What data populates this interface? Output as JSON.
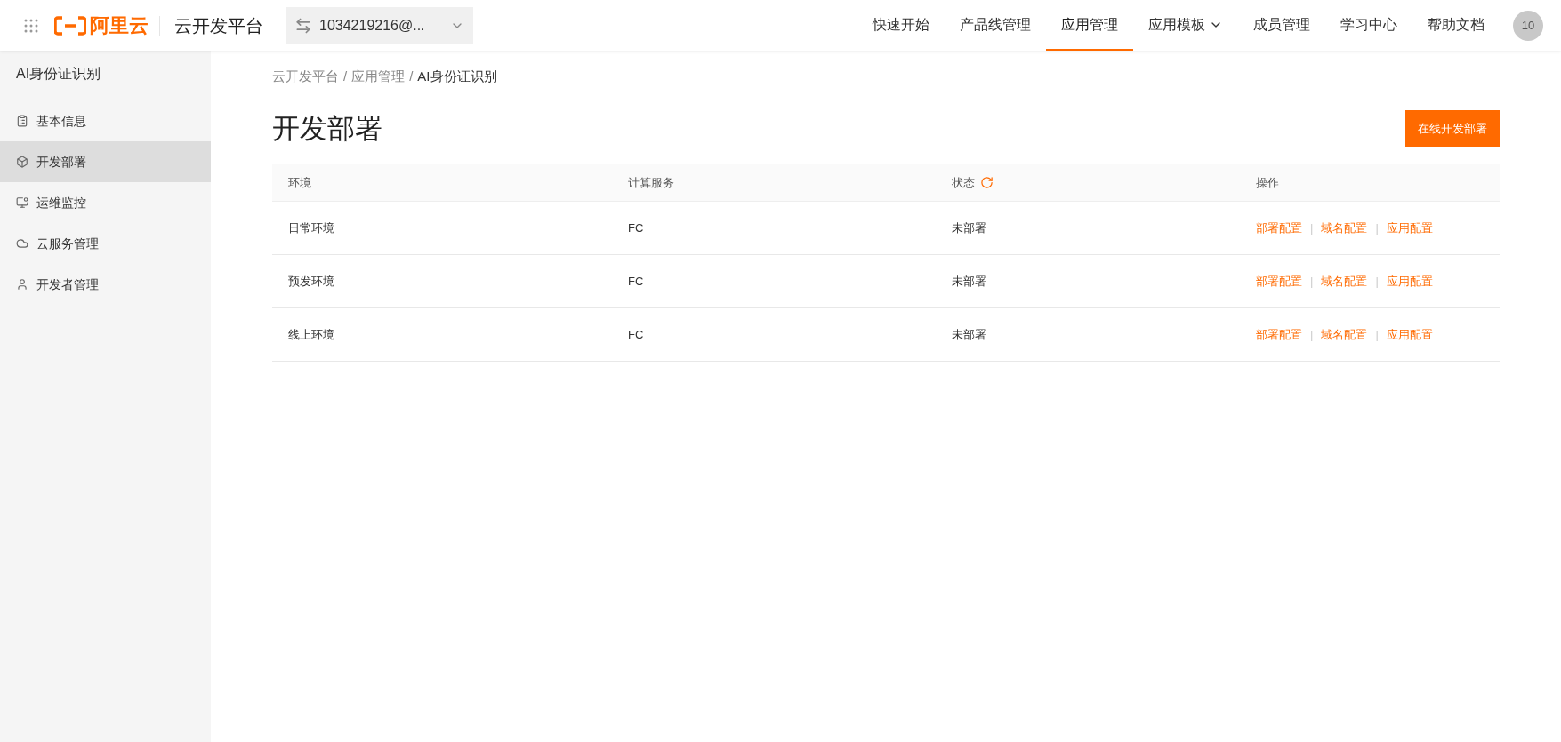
{
  "header": {
    "logo_text": "阿里云",
    "platform": "云开发平台",
    "account": "1034219216@...",
    "nav": [
      {
        "label": "快速开始",
        "selected": false,
        "dropdown": false
      },
      {
        "label": "产品线管理",
        "selected": false,
        "dropdown": false
      },
      {
        "label": "应用管理",
        "selected": true,
        "dropdown": false
      },
      {
        "label": "应用模板",
        "selected": false,
        "dropdown": true
      },
      {
        "label": "成员管理",
        "selected": false,
        "dropdown": false
      },
      {
        "label": "学习中心",
        "selected": false,
        "dropdown": false
      },
      {
        "label": "帮助文档",
        "selected": false,
        "dropdown": false
      }
    ],
    "avatar": "10"
  },
  "sidebar": {
    "title": "AI身份证识别",
    "items": [
      {
        "label": "基本信息",
        "kind": "doc",
        "selected": false
      },
      {
        "label": "开发部署",
        "kind": "cube",
        "selected": true
      },
      {
        "label": "运维监控",
        "kind": "monitor",
        "selected": false
      },
      {
        "label": "云服务管理",
        "kind": "cloud",
        "selected": false
      },
      {
        "label": "开发者管理",
        "kind": "user",
        "selected": false
      }
    ]
  },
  "breadcrumb": {
    "separator": "/",
    "items": [
      "云开发平台",
      "应用管理",
      "AI身份证识别"
    ]
  },
  "page_title": "开发部署",
  "primary_button": "在线开发部署",
  "table": {
    "columns": [
      "环境",
      "计算服务",
      "状态",
      "操作"
    ],
    "rows": [
      {
        "env": "日常环境",
        "service": "FC",
        "status": "未部署",
        "actions": [
          "部署配置",
          "域名配置",
          "应用配置"
        ]
      },
      {
        "env": "预发环境",
        "service": "FC",
        "status": "未部署",
        "actions": [
          "部署配置",
          "域名配置",
          "应用配置"
        ]
      },
      {
        "env": "线上环境",
        "service": "FC",
        "status": "未部署",
        "actions": [
          "部署配置",
          "域名配置",
          "应用配置"
        ]
      }
    ],
    "action_separator": "|"
  }
}
